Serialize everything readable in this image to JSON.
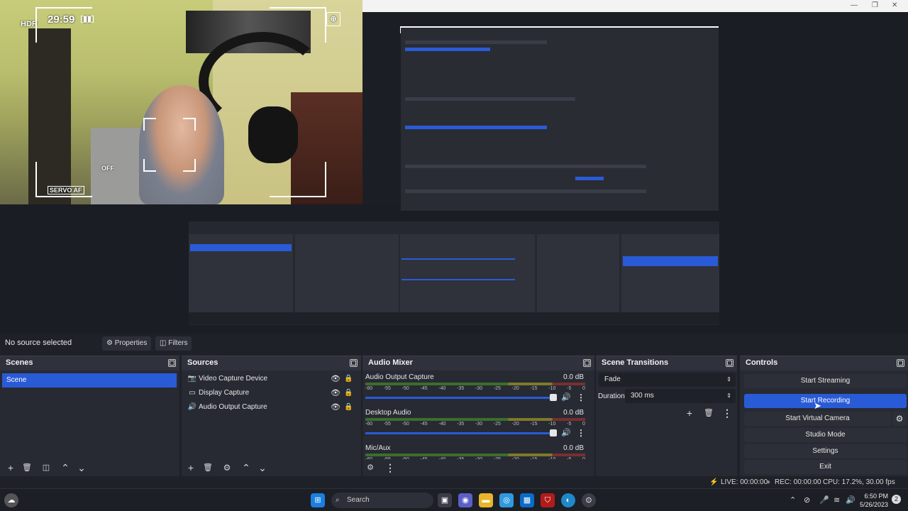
{
  "camera_overlay": {
    "hdr": "HDR",
    "timer": "29:59",
    "servo": "SERVO AF",
    "off": "OFF"
  },
  "toolbar": {
    "no_source": "No source selected",
    "properties": "Properties",
    "filters": "Filters"
  },
  "scenes": {
    "title": "Scenes",
    "items": [
      "Scene"
    ]
  },
  "sources": {
    "title": "Sources",
    "items": [
      {
        "label": "Video Capture Device",
        "icon": "camera-icon"
      },
      {
        "label": "Display Capture",
        "icon": "monitor-icon"
      },
      {
        "label": "Audio Output Capture",
        "icon": "speaker-icon"
      }
    ]
  },
  "mixer": {
    "title": "Audio Mixer",
    "channels": [
      {
        "name": "Audio Output Capture",
        "db": "0.0 dB"
      },
      {
        "name": "Desktop Audio",
        "db": "0.0 dB"
      },
      {
        "name": "Mic/Aux",
        "db": "0.0 dB"
      }
    ],
    "ticks": [
      "-60",
      "-55",
      "-50",
      "-45",
      "-40",
      "-35",
      "-30",
      "-25",
      "-20",
      "-15",
      "-10",
      "-5",
      "0"
    ]
  },
  "transitions": {
    "title": "Scene Transitions",
    "selected": "Fade",
    "duration_label": "Duration",
    "duration_value": "300 ms"
  },
  "controls": {
    "title": "Controls",
    "start_streaming": "Start Streaming",
    "start_recording": "Start Recording",
    "start_virtual_camera": "Start Virtual Camera",
    "studio_mode": "Studio Mode",
    "settings": "Settings",
    "exit": "Exit"
  },
  "status": {
    "live": "LIVE: 00:00:00",
    "rec": "REC: 00:00:00",
    "cpu": "CPU: 17.2%, 30.00 fps"
  },
  "taskbar": {
    "search": "Search",
    "time": "6:50 PM",
    "date": "5/26/2023",
    "notifications": "2"
  },
  "colors": {
    "accent": "#2a5bd7",
    "panel": "#272a33",
    "background": "#1f2128"
  }
}
